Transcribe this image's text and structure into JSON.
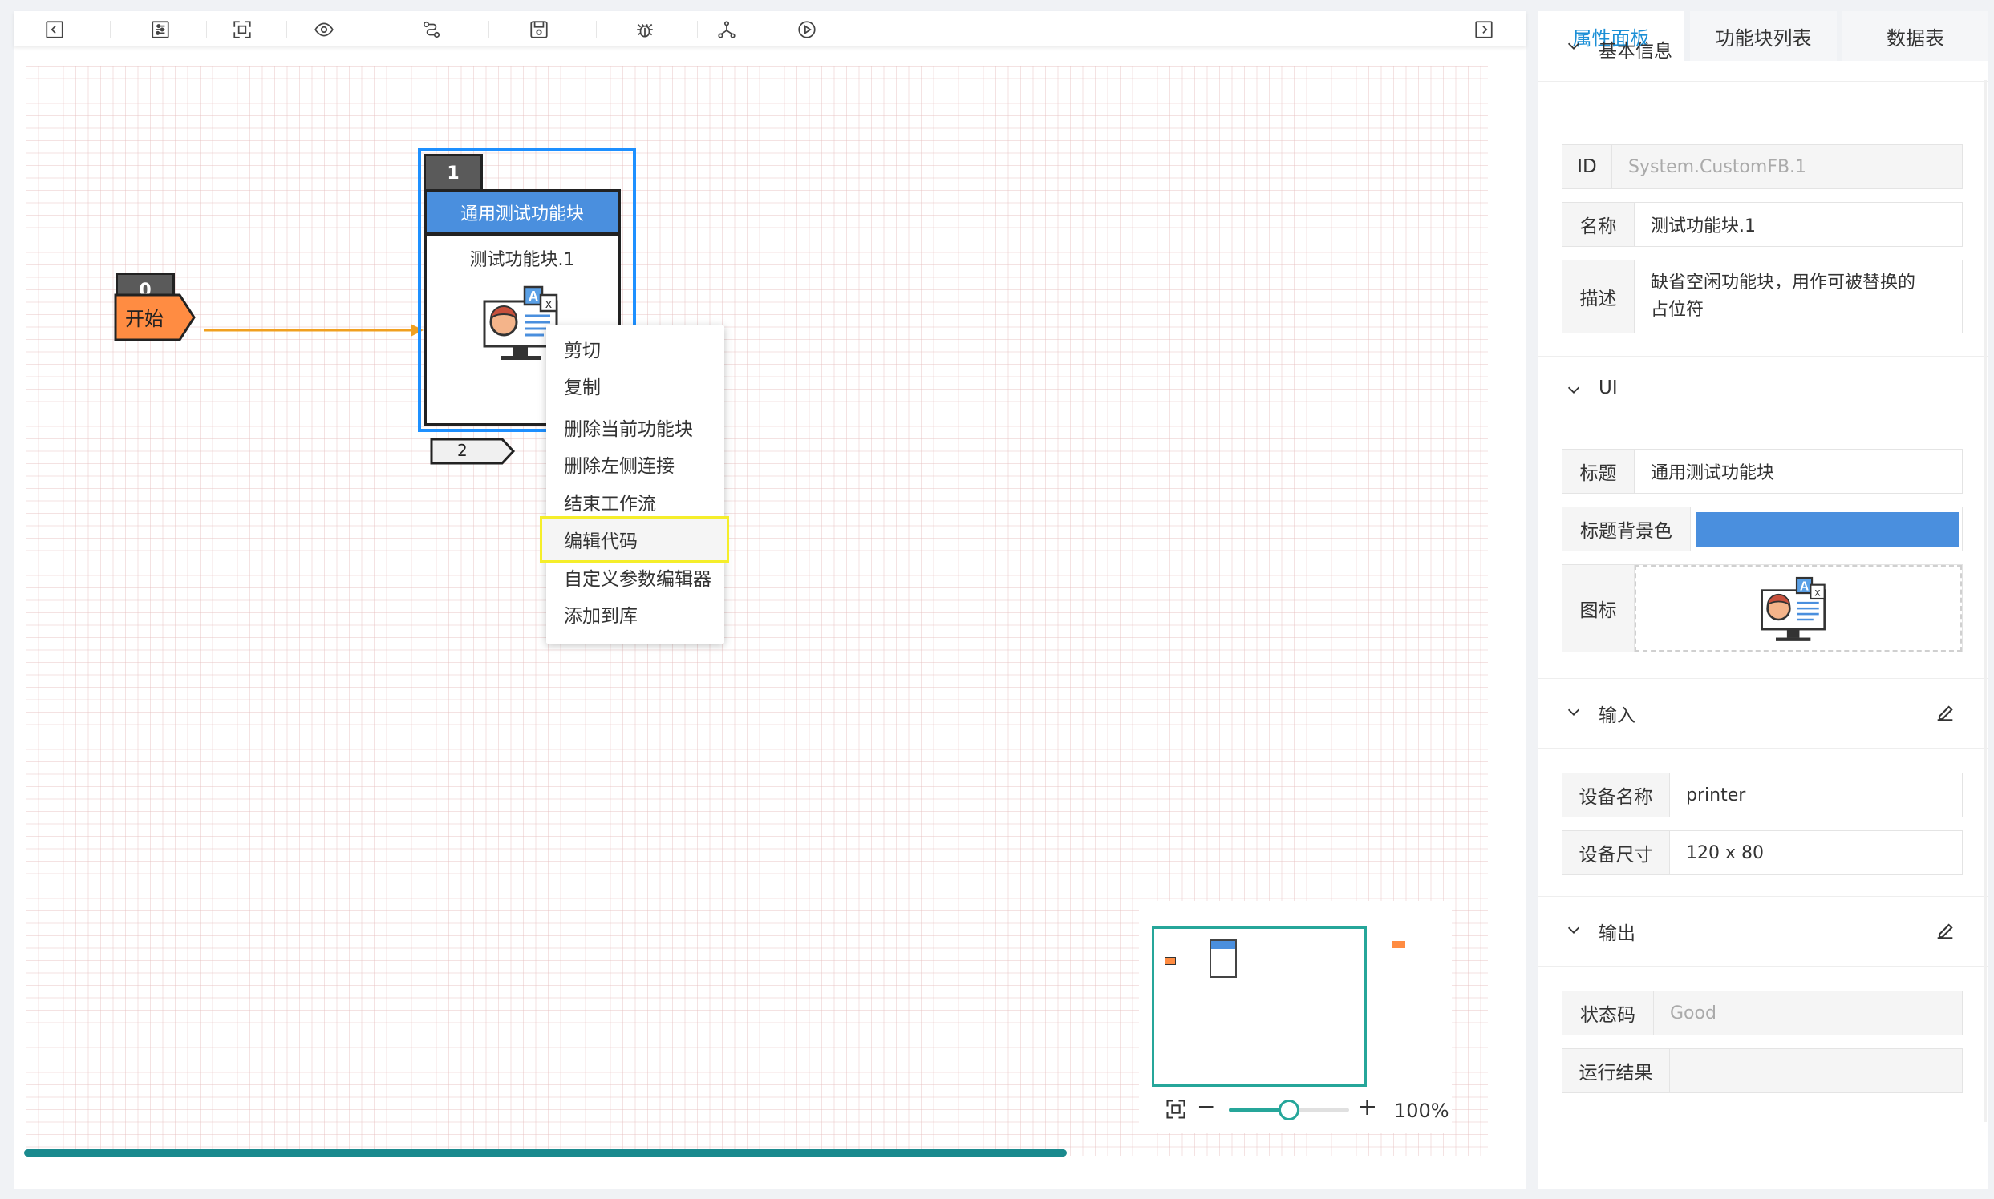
{
  "panel": {
    "tabs": [
      "属性面板",
      "功能块列表",
      "数据表"
    ],
    "basic": {
      "title": "基本信息",
      "rows": [
        {
          "label": "ID",
          "value": "System.CustomFB.1"
        },
        {
          "label": "名称",
          "value": "测试功能块.1"
        },
        {
          "label": "描述",
          "value": "缺省空闲功能块，用作可被替换的占位符"
        }
      ]
    },
    "ui": {
      "title": "UI",
      "rows": [
        {
          "label": "标题",
          "value": "通用测试功能块"
        },
        {
          "label": "标题背景色",
          "value": "#4a8fde"
        },
        {
          "label": "图标",
          "value": ""
        }
      ]
    },
    "input": {
      "title": "输入",
      "rows": [
        {
          "label": "设备名称",
          "value": "printer"
        },
        {
          "label": "设备尺寸",
          "value": "120 x 80"
        }
      ]
    },
    "output": {
      "title": "输出",
      "rows": [
        {
          "label": "状态码",
          "value": "Good"
        },
        {
          "label": "运行结果",
          "value": ""
        }
      ]
    }
  },
  "canvas": {
    "start_node": {
      "index": "0",
      "label": "开始"
    },
    "fb_node": {
      "index": "1",
      "title": "通用测试功能块",
      "name": "测试功能块.1",
      "port": "2"
    }
  },
  "context_menu": {
    "items": [
      "剪切",
      "复制",
      "删除当前功能块",
      "删除左侧连接",
      "结束工作流",
      "编辑代码",
      "自定义参数编辑器",
      "添加到库"
    ],
    "highlighted": "编辑代码"
  },
  "zoom": {
    "value": "100%",
    "minus": "−",
    "plus": "+",
    "level": 0.5
  },
  "colors": {
    "accent": "#1b8fd6",
    "title_bg": "#4a8fde",
    "start": "#ff8c42",
    "link": "#f0a020",
    "minimap": "#26a69a",
    "highlight": "#f5ee2a"
  },
  "toolbar_icons": [
    "collapse-left-icon",
    "sliders-icon",
    "fit-view-icon",
    "eye-icon",
    "route-icon",
    "save-icon",
    "bug-icon",
    "network-icon",
    "play-icon",
    "collapse-right-icon"
  ]
}
